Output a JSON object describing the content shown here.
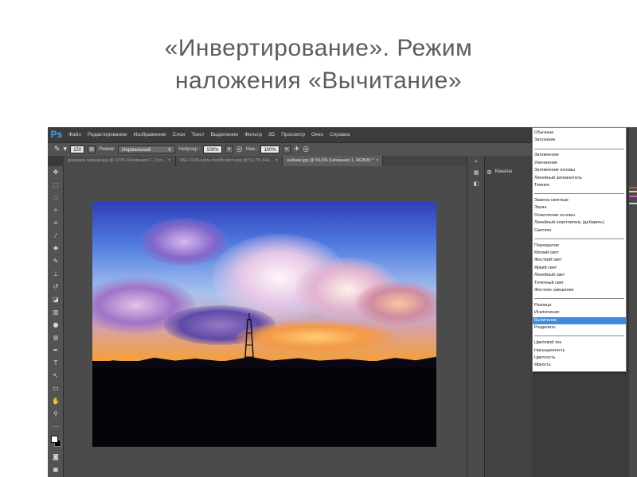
{
  "slide": {
    "title_line1": "«Инвертирование». Режим",
    "title_line2": "наложения «Вычитание»"
  },
  "app": {
    "logo": "Ps",
    "menu": [
      "Файл",
      "Редактирование",
      "Изображение",
      "Слои",
      "Текст",
      "Выделение",
      "Фильтр",
      "3D",
      "Просмотр",
      "Окно",
      "Справка"
    ]
  },
  "options": {
    "brush_size": "150",
    "mode_label": "Режим:",
    "mode_value": "Нормальный",
    "opacity_label": "Непрозр.:",
    "opacity_value": "100%",
    "flow_label": "Наж.:",
    "flow_value": "100%"
  },
  "tabs": [
    {
      "label": "девушка нейзаж.jpg @ 110% (Незвания 1, Сло...",
      "active": false
    },
    {
      "label": "VAZ-2106-early-modification.jpg @ 53,7% (Не...",
      "active": false
    },
    {
      "label": "нейзаж.jpg @ 66,6% (Незвания 1, RGB/8) *",
      "active": true
    }
  ],
  "panels": {
    "channels_label": "Каналы"
  },
  "blend_modes": {
    "groups": [
      [
        "Обычные",
        "Затухание"
      ],
      [
        "Затемнение",
        "Умножение",
        "Затемнение основы",
        "Линейный затемнитель",
        "Темнее"
      ],
      [
        "Замена светлым",
        "Экран",
        "Осветление основы",
        "Линейный осветлитель (добавить)",
        "Светлее"
      ],
      [
        "Перекрытие",
        "Мягкий свет",
        "Жесткий свет",
        "Яркий свет",
        "Линейный свет",
        "Точечный свет",
        "Жесткое смешение"
      ],
      [
        "Разница",
        "Исключение",
        "Вычитание",
        "Разделить"
      ],
      [
        "Цветовой тон",
        "Насыщенность",
        "Цветность",
        "Яркость"
      ]
    ],
    "selected": "Вычитание"
  },
  "colors": {
    "selection_blue": "#3e8bdc",
    "ps_blue": "#3ea6ea",
    "ui_dark": "#3c3c3c"
  }
}
